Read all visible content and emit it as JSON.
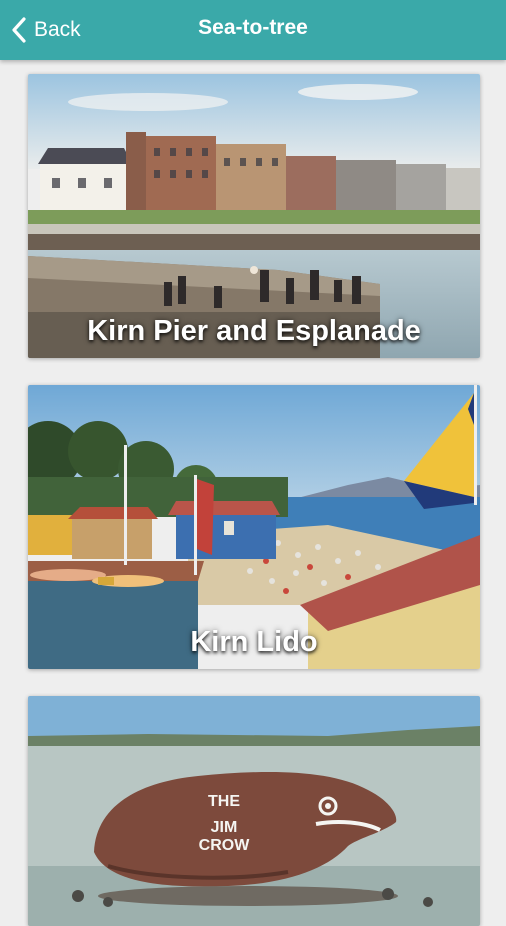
{
  "header": {
    "back_label": "Back",
    "title": "Sea-to-tree",
    "background": "#3aa9a9"
  },
  "cards": [
    {
      "label": "Kirn Pier and Esplanade"
    },
    {
      "label": "Kirn Lido"
    },
    {
      "label": "",
      "image_text_line1": "THE",
      "image_text_line2": "JIM",
      "image_text_line3": "CROW"
    }
  ]
}
